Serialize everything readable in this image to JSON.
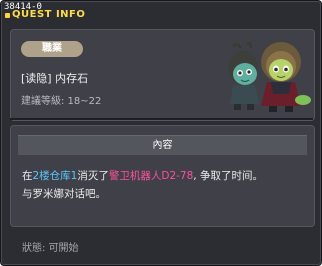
{
  "quest_id": "38414-0",
  "window_title": "QUEST INFO",
  "job_badge": "職業",
  "quest_name": "[读隐] 内存石",
  "level_recommendation": "建議等級: 18~22",
  "content_header": "內容",
  "content": {
    "prefix": "在",
    "location": "2楼仓库1",
    "middle": "消灭了",
    "target": "警卫机器人D2-78",
    "suffix": ", 争取了时间。",
    "line2": "与罗米娜对话吧。"
  },
  "status": "狀態: 可開始",
  "colors": {
    "title": "#ffdc4b",
    "highlight_location": "#5ac8ff",
    "highlight_target": "#ff4fa0",
    "badge": "#b0a18a"
  }
}
